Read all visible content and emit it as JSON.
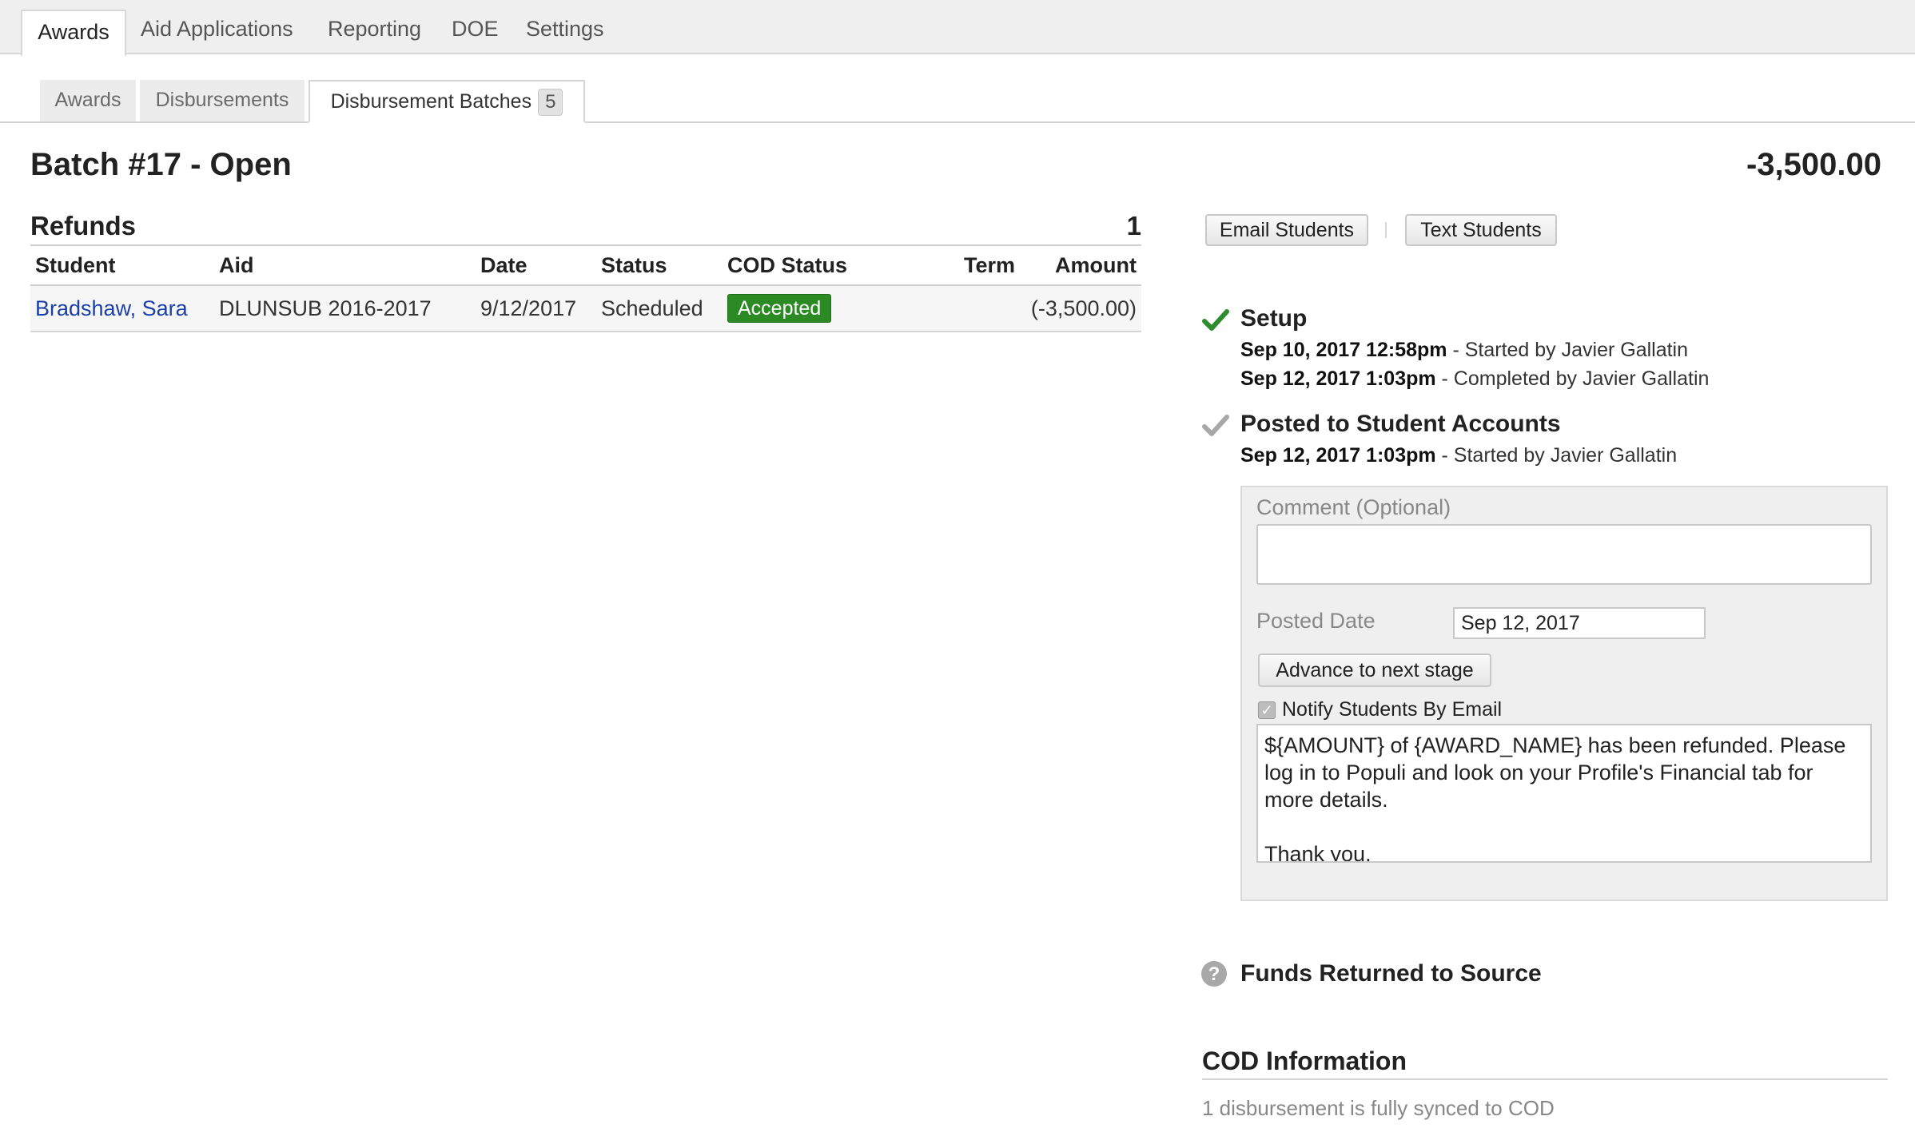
{
  "topnav": {
    "tabs": [
      {
        "label": "Awards",
        "active": true
      },
      {
        "label": "Aid Applications"
      },
      {
        "label": "Reporting"
      },
      {
        "label": "DOE"
      },
      {
        "label": "Settings"
      }
    ]
  },
  "subtabs": {
    "awards": "Awards",
    "disbursements": "Disbursements",
    "batches": "Disbursement Batches",
    "batches_count": "5"
  },
  "batch": {
    "title": "Batch #17 - Open",
    "total": "-3,500.00"
  },
  "refunds": {
    "title": "Refunds",
    "count": "1",
    "columns": [
      "Student",
      "Aid",
      "Date",
      "Status",
      "COD Status",
      "Term",
      "Amount"
    ],
    "rows": [
      {
        "student": "Bradshaw, Sara",
        "aid": "DLUNSUB 2016-2017",
        "date": "9/12/2017",
        "status": "Scheduled",
        "cod_status": "Accepted",
        "term": "",
        "amount": "(-3,500.00)"
      }
    ]
  },
  "actions": {
    "email_students": "Email Students",
    "text_students": "Text Students"
  },
  "stages": {
    "setup": {
      "title": "Setup",
      "icon": "check-icon",
      "lines": [
        {
          "when": "Sep 10, 2017 12:58pm",
          "what": " - Started by Javier Gallatin"
        },
        {
          "when": "Sep 12, 2017 1:03pm",
          "what": " - Completed by Javier Gallatin"
        }
      ]
    },
    "posted": {
      "title": "Posted to Student Accounts",
      "icon": "check-icon",
      "lines": [
        {
          "when": "Sep 12, 2017 1:03pm",
          "what": " - Started by Javier Gallatin"
        }
      ]
    },
    "funds": {
      "title": "Funds Returned to Source",
      "icon": "question-icon"
    }
  },
  "panel": {
    "comment_label": "Comment (Optional)",
    "comment_value": "",
    "posted_date_label": "Posted Date",
    "posted_date_value": "Sep 12, 2017",
    "advance_button": "Advance to next stage",
    "notify_label": "Notify Students By Email",
    "notify_checked": true,
    "email_body": "${AMOUNT} of {AWARD_NAME} has been refunded. Please log in to Populi and look on your Profile's Financial tab for more details.\n\nThank you."
  },
  "cod": {
    "title": "COD Information",
    "sync_status": "1 disbursement is fully synced to COD"
  },
  "colors": {
    "accepted": "#2b8a23",
    "negative": "#d8231c",
    "link": "#1b3fa8",
    "check_done": "#2e8b2e",
    "check_pending": "#a8a8a8"
  }
}
